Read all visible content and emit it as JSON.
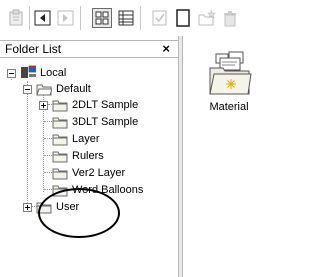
{
  "toolbar": {
    "buttons": [
      {
        "name": "clipboard-icon",
        "enabled": false
      },
      {
        "name": "back-icon",
        "enabled": true
      },
      {
        "name": "forward-icon",
        "enabled": false
      },
      {
        "name": "thumbnail-view-icon",
        "enabled": true,
        "pressed": true
      },
      {
        "name": "list-view-icon",
        "enabled": true
      },
      {
        "name": "check-icon",
        "enabled": false
      },
      {
        "name": "new-page-icon",
        "enabled": true
      },
      {
        "name": "new-folder-icon",
        "enabled": false
      },
      {
        "name": "trash-icon",
        "enabled": false
      }
    ]
  },
  "folder_list": {
    "title": "Folder List",
    "close": "×",
    "tree": {
      "root": "Local",
      "default": "Default",
      "children": [
        "2DLT Sample",
        "3DLT Sample",
        "Layer",
        "Rulers",
        "Ver2 Layer",
        "Word Balloons"
      ],
      "user": "User"
    }
  },
  "content": {
    "item_label": "Material"
  },
  "colors": {
    "folder_fill": "#f3f3e9",
    "folder_stroke": "#6b6b6b",
    "background": "#ffffff"
  }
}
